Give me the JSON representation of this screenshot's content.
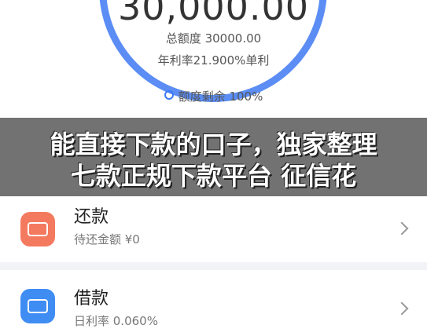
{
  "quota_panel": {
    "amount": "30,000.00",
    "total_quota": "总额度 30000.00",
    "annual_rate": "年利率21.900%单利",
    "remaining": "额度剩余 100%"
  },
  "overlay": {
    "line1": "能直接下款的口子，独家整理",
    "line2": "七款正规下款平台 征信花"
  },
  "items": [
    {
      "title": "还款",
      "subtitle": "待还金额 ¥0",
      "icon": "repay-card-icon"
    },
    {
      "title": "借款",
      "subtitle": "日利率 0.060%",
      "icon": "borrow-card-icon"
    }
  ],
  "colors": {
    "ring": "#5b8df5",
    "repay_icon": "#f47a5f",
    "borrow_icon": "#3f8df3"
  }
}
